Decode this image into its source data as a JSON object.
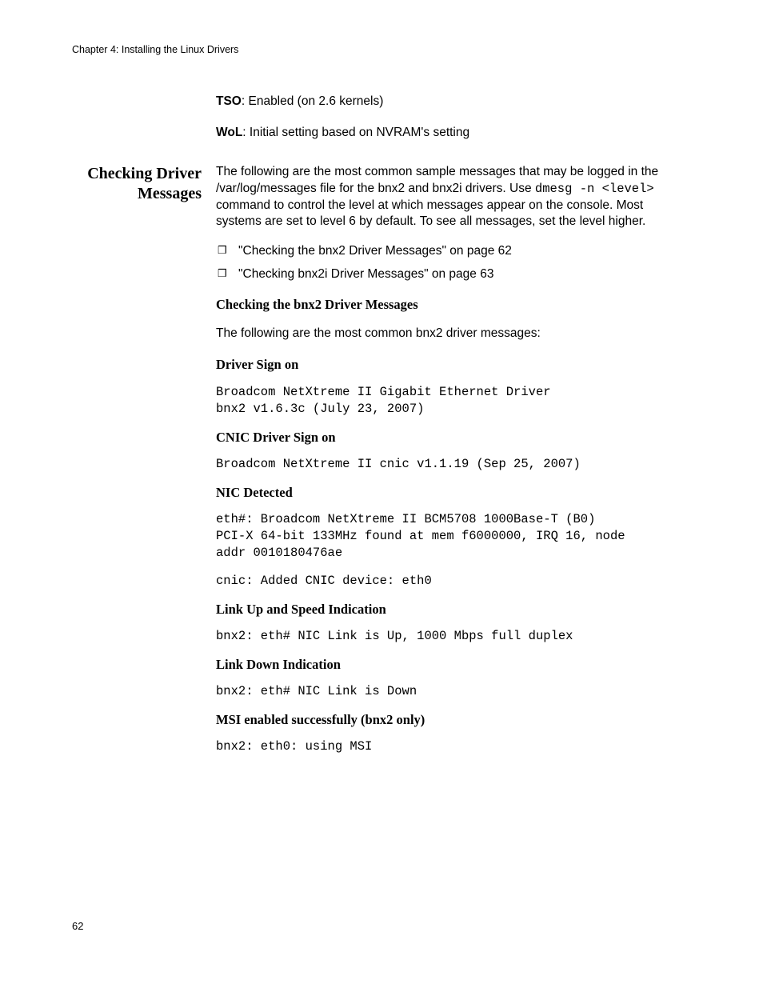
{
  "header": {
    "running_head": "Chapter 4: Installing the Linux Drivers"
  },
  "top_params": {
    "tso_label": "TSO",
    "tso_text": ": Enabled (on 2.6 kernels)",
    "wol_label": "WoL",
    "wol_text": ": Initial setting based on NVRAM's setting"
  },
  "side": {
    "checking_driver": "Checking Driver",
    "messages": "Messages"
  },
  "intro": {
    "part1": "The following are the most common sample messages that may be logged in the /var/log/messages file for the bnx2 and bnx2i drivers. Use ",
    "cmd": "dmesg -n <level>",
    "part2": " command to control the level at which messages appear on the console. Most systems are set to level 6 by default. To see all messages, set the level higher."
  },
  "bullets": {
    "b1": "\"Checking the bnx2 Driver Messages\" on page 62",
    "b2": "\"Checking bnx2i Driver Messages\" on page 63"
  },
  "sections": {
    "h_bnx2": "Checking the bnx2 Driver Messages",
    "p_bnx2": "The following are the most common bnx2 driver messages:",
    "h_signon": "Driver Sign on",
    "c_signon": "Broadcom NetXtreme II Gigabit Ethernet Driver\nbnx2 v1.6.3c (July 23, 2007)",
    "h_cnic": "CNIC Driver Sign on",
    "c_cnic": "Broadcom NetXtreme II cnic v1.1.19 (Sep 25, 2007)",
    "h_nic": "NIC Detected",
    "c_nic1": "eth#: Broadcom NetXtreme II BCM5708 1000Base-T (B0)\nPCI-X 64-bit 133MHz found at mem f6000000, IRQ 16, node\naddr 0010180476ae",
    "c_nic2": "cnic: Added CNIC device: eth0",
    "h_linkup": "Link Up and Speed Indication",
    "c_linkup": "bnx2: eth# NIC Link is Up, 1000 Mbps full duplex",
    "h_linkdown": "Link Down Indication",
    "c_linkdown": "bnx2: eth# NIC Link is Down",
    "h_msi": "MSI enabled successfully (bnx2 only)",
    "c_msi": "bnx2: eth0: using MSI"
  },
  "footer": {
    "page_num": "62"
  }
}
